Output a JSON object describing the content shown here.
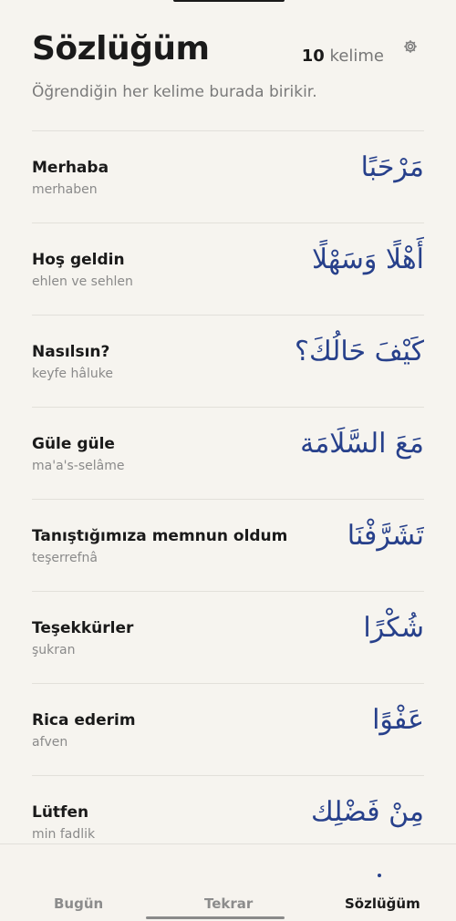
{
  "header": {
    "title": "Sözlüğüm",
    "count_number": "10",
    "count_unit": "kelime",
    "settings_icon": "gear-icon",
    "subtitle": "Öğrendiğin her kelime burada birikir."
  },
  "words": [
    {
      "turkish": "Merhaba",
      "translit": "merhaben",
      "arabic": "مَرْحَبًا"
    },
    {
      "turkish": "Hoş geldin",
      "translit": "ehlen ve sehlen",
      "arabic": "أَهْلًا وَسَهْلًا"
    },
    {
      "turkish": "Nasılsın?",
      "translit": "keyfe hâluke",
      "arabic": "كَيْفَ حَالُكَ؟"
    },
    {
      "turkish": "Güle güle",
      "translit": "ma'a's-selâme",
      "arabic": "مَعَ السَّلَامَة"
    },
    {
      "turkish": "Tanıştığımıza memnun oldum",
      "translit": "teşerrefnâ",
      "arabic": "تَشَرَّفْنَا"
    },
    {
      "turkish": "Teşekkürler",
      "translit": "şukran",
      "arabic": "شُكْرًا"
    },
    {
      "turkish": "Rica ederim",
      "translit": "afven",
      "arabic": "عَفْوًا"
    },
    {
      "turkish": "Lütfen",
      "translit": "min fadlik",
      "arabic": "مِنْ فَضْلِك"
    }
  ],
  "tabs": [
    {
      "label": "Bugün",
      "active": false
    },
    {
      "label": "Tekrar",
      "active": false
    },
    {
      "label": "Sözlüğüm",
      "active": true
    }
  ],
  "colors": {
    "background": "#f6f4ef",
    "arabic_text": "#27408b",
    "primary_text": "#1a1a1a",
    "secondary_text": "#8a8a8a"
  }
}
